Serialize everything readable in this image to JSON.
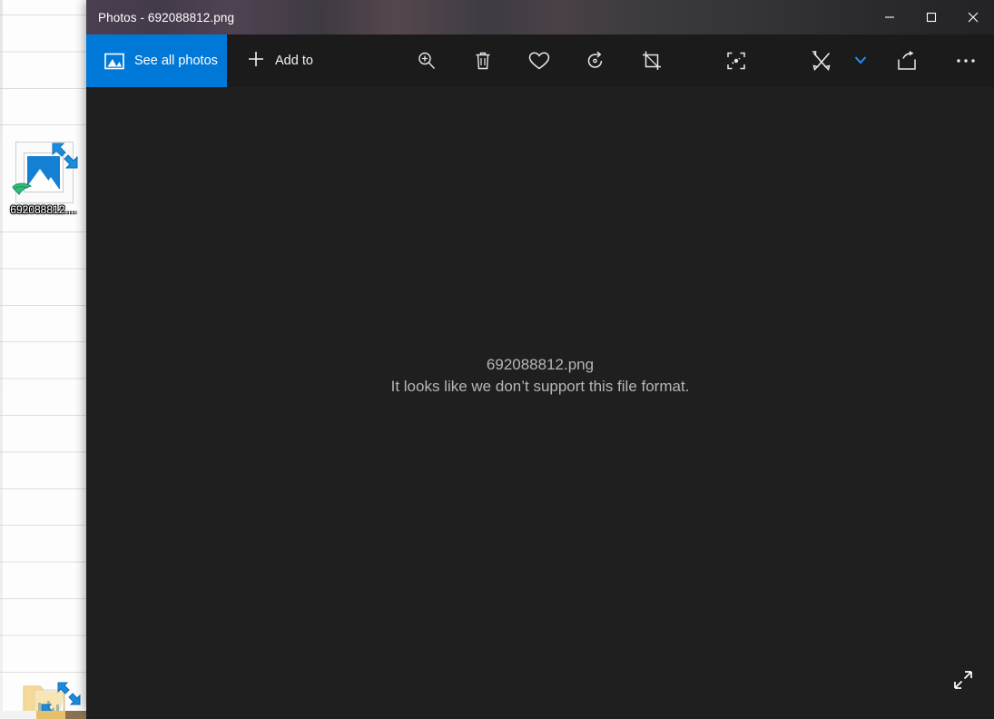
{
  "window": {
    "title": "Photos - 692088812.png",
    "caption_buttons": [
      {
        "name": "minimize",
        "label": "Minimize"
      },
      {
        "name": "maximize",
        "label": "Maximize"
      },
      {
        "name": "close",
        "label": "Close"
      }
    ]
  },
  "toolbar": {
    "see_all_photos_label": "See all photos",
    "see_all_photos_icon": "photo-icon",
    "add_to_label": "Add to",
    "add_to_icon": "plus-icon",
    "tools": [
      {
        "name": "zoom",
        "icon": "zoom-in-icon",
        "label": "Zoom"
      },
      {
        "name": "delete",
        "icon": "trash-icon",
        "label": "Delete"
      },
      {
        "name": "favorite",
        "icon": "heart-icon",
        "label": "Add to favorites"
      },
      {
        "name": "rotate",
        "icon": "rotate-icon",
        "label": "Rotate"
      },
      {
        "name": "crop",
        "icon": "crop-icon",
        "label": "Crop and rotate"
      },
      {
        "name": "enhance",
        "icon": "magic-enhance-icon",
        "label": "Enhance your photo"
      }
    ],
    "edit_create": {
      "icon": "edit-create-icon",
      "label": "Edit & Create",
      "chevron": "chevron-down-icon"
    },
    "share": {
      "icon": "share-icon",
      "label": "Share"
    },
    "see_more": {
      "icon": "ellipsis-icon",
      "label": "See more"
    }
  },
  "content": {
    "file_name": "692088812.png",
    "error_message": "It looks like we don’t support this file format.",
    "fullscreen_icon": "fullscreen-arrows-icon"
  },
  "desktop": {
    "icons": [
      {
        "name": "image-file",
        "label": "692088812....",
        "icon": "image-zip-icon"
      },
      {
        "name": "folder-file",
        "label": "",
        "icon": "folder-zip-icon"
      }
    ]
  },
  "colors": {
    "accent": "#0078d7",
    "window_bg": "#1f1f1f",
    "command_bar_bg": "#1b1b1b",
    "text_muted": "#b6b6b6",
    "close_hover": "#e81123"
  }
}
